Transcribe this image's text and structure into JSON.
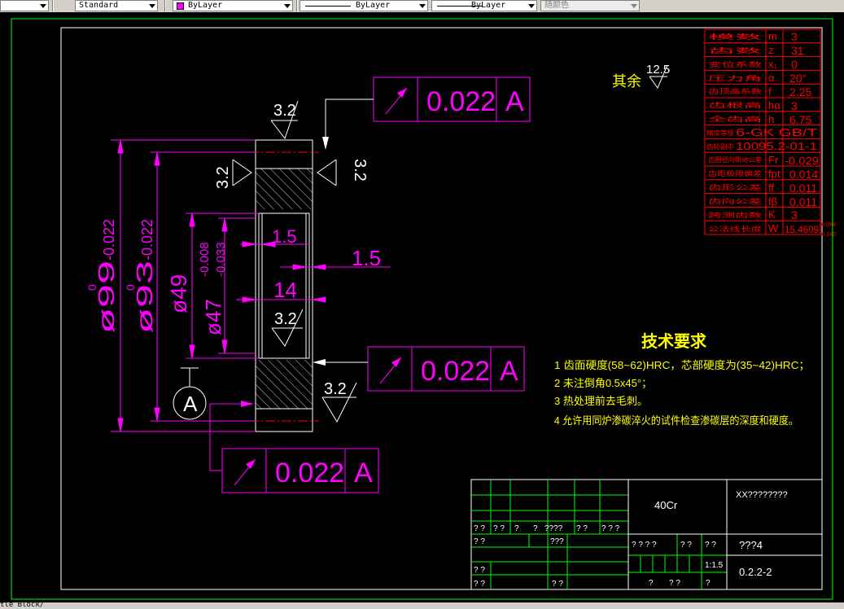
{
  "toolbar": {
    "text_style": "Standard",
    "color": "ByLayer",
    "linetype": "ByLayer",
    "lineweight": "ByLayer",
    "plot_style": "随颜色",
    "color_accent": "#ff00ff"
  },
  "drawing": {
    "surface_roughness_note": "其余",
    "default_roughness": "12.5",
    "roughness_values": [
      "3.2",
      "3.2",
      "3.2",
      "3.2",
      "3.2"
    ],
    "datum_label": "A",
    "tolerance_frames": [
      {
        "value": "0.022",
        "datum": "A"
      },
      {
        "value": "0.022",
        "datum": "A"
      },
      {
        "value": "0.022",
        "datum": "A"
      }
    ],
    "dimensions": {
      "outer_dia": "ø99",
      "outer_tol_upper": "0",
      "outer_tol_lower": "-0.022",
      "pitch_dia": "ø93",
      "pitch_tol_upper": "0",
      "pitch_tol_lower": "-0.022",
      "bore_dia": "ø49",
      "groove_dia": "ø47",
      "groove_tol_upper": "-0.008",
      "groove_tol_lower": "-0.033",
      "groove_width": "1.5",
      "width": "14",
      "chamfer": "1.5"
    }
  },
  "parameter_table": {
    "rows": [
      {
        "name": "模数",
        "symbol": "m",
        "value": "3"
      },
      {
        "name": "齿数",
        "symbol": "z",
        "value": "31"
      },
      {
        "name": "变位系数",
        "symbol": "x₁",
        "value": "0"
      },
      {
        "name": "压力角",
        "symbol": "α",
        "value": "20°"
      },
      {
        "name": "齿顶高系数",
        "symbol": "f",
        "value": "2.25"
      },
      {
        "name": "齿根高",
        "symbol": "hα",
        "value": "3"
      },
      {
        "name": "全齿高",
        "symbol": "h",
        "value": "6.75"
      },
      {
        "name": "精度等级",
        "symbol": "",
        "value": "6-GK GB/T"
      },
      {
        "name": "齿轮副中",
        "symbol": "",
        "value": "10095.2-01-1"
      },
      {
        "name": "齿圈径向跳动公差",
        "symbol": "Fr",
        "value": "-0.029"
      },
      {
        "name": "齿距极限偏差",
        "symbol": "fpt",
        "value": "0.014"
      },
      {
        "name": "齿形公差",
        "symbol": "ff",
        "value": "0.011"
      },
      {
        "name": "齿向公差",
        "symbol": "fβ",
        "value": "0.011"
      },
      {
        "name": "跨测齿数",
        "symbol": "K",
        "value": "3"
      },
      {
        "name": "公法线长度",
        "symbol": "W",
        "value": "15.4609"
      }
    ],
    "w_tol_upper": "-0.084",
    "w_tol_lower": "-0.140"
  },
  "technical_requirements": {
    "title": "技术要求",
    "items": [
      "1  齿面硬度(58~62)HRC，芯部硬度为(35~42)HRC；",
      "2  未注倒角0.5x45°；",
      "3  热处理前去毛刺。",
      "4  允许用同炉渗碳淬火的试件检查渗碳层的深度和硬度。"
    ]
  },
  "title_block": {
    "material": "40Cr",
    "company": "XX????????",
    "part_name": "???4",
    "drawing_no": "0.2.2-2",
    "scale": "1:1.5",
    "row_labels_a": [
      "? ?",
      "? ?",
      "?",
      "?",
      "????",
      "? ?",
      "? ? ?"
    ],
    "row_labels_b": [
      "? ?",
      "???"
    ],
    "row_labels_c": [
      "? ?"
    ],
    "row_labels_d": [
      "? ?",
      "? ?"
    ],
    "weight_row": [
      "? ? ? ?",
      "? ?",
      "? ?"
    ],
    "sheet_row": [
      "?",
      "? ?",
      "?"
    ]
  },
  "status": {
    "command_line": "tle Block/"
  }
}
